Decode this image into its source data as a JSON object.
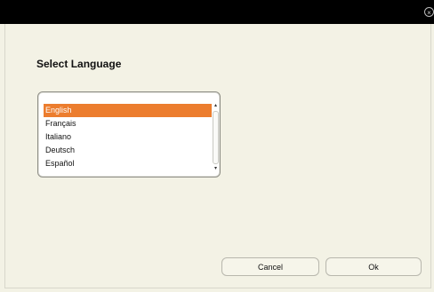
{
  "window": {
    "close_icon_glyph": "×"
  },
  "dialog": {
    "heading": "Select Language",
    "languages": [
      "English",
      "Français",
      "Italiano",
      "Deutsch",
      "Español"
    ],
    "selected_language": "English",
    "scroll_up_glyph": "▴",
    "scroll_down_glyph": "▾"
  },
  "buttons": {
    "cancel_label": "Cancel",
    "ok_label": "Ok"
  },
  "colors": {
    "selection": "#ec7d2e",
    "background": "#f3f2e5",
    "titlebar": "#000000"
  }
}
